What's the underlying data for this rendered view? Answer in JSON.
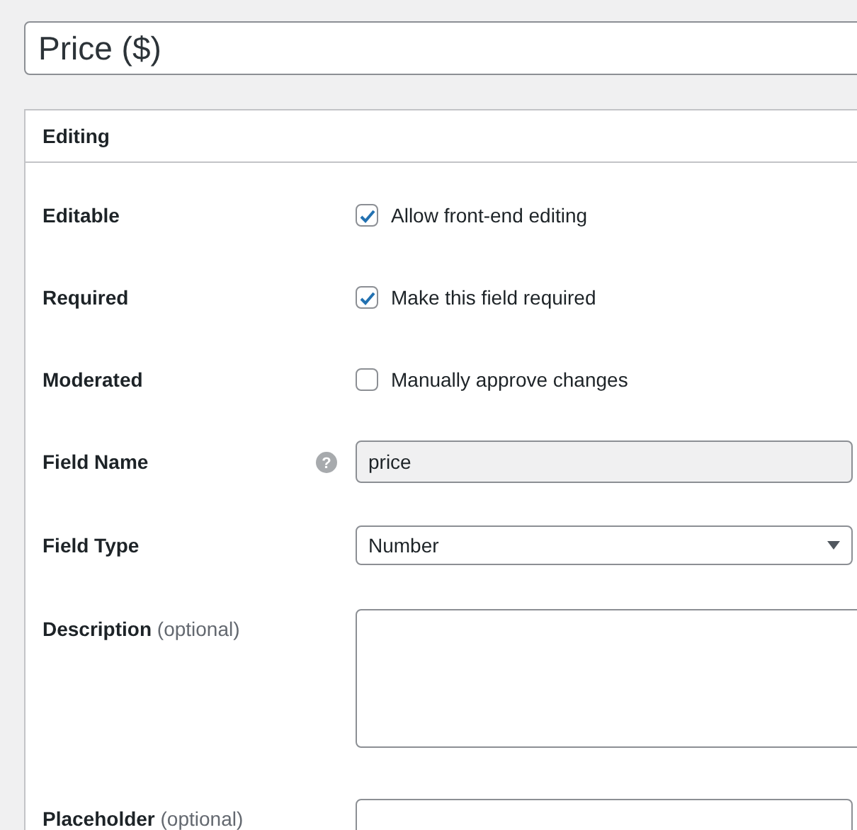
{
  "title_field": {
    "value": "Price ($)"
  },
  "panel": {
    "title": "Editing",
    "rows": [
      {
        "kind": "checkbox",
        "label": "Editable",
        "option": "Allow front-end editing",
        "checked": true
      },
      {
        "kind": "checkbox",
        "label": "Required",
        "option": "Make this field required",
        "checked": true
      },
      {
        "kind": "checkbox",
        "label": "Moderated",
        "option": "Manually approve changes",
        "checked": false
      },
      {
        "kind": "text",
        "label": "Field Name",
        "value": "price",
        "disabled": true,
        "help_symbol": "?"
      },
      {
        "kind": "select",
        "label": "Field Type",
        "value": "Number"
      },
      {
        "kind": "textarea",
        "label": "Description",
        "note": "(optional)"
      },
      {
        "kind": "input",
        "label": "Placeholder",
        "note": "(optional)"
      }
    ]
  }
}
